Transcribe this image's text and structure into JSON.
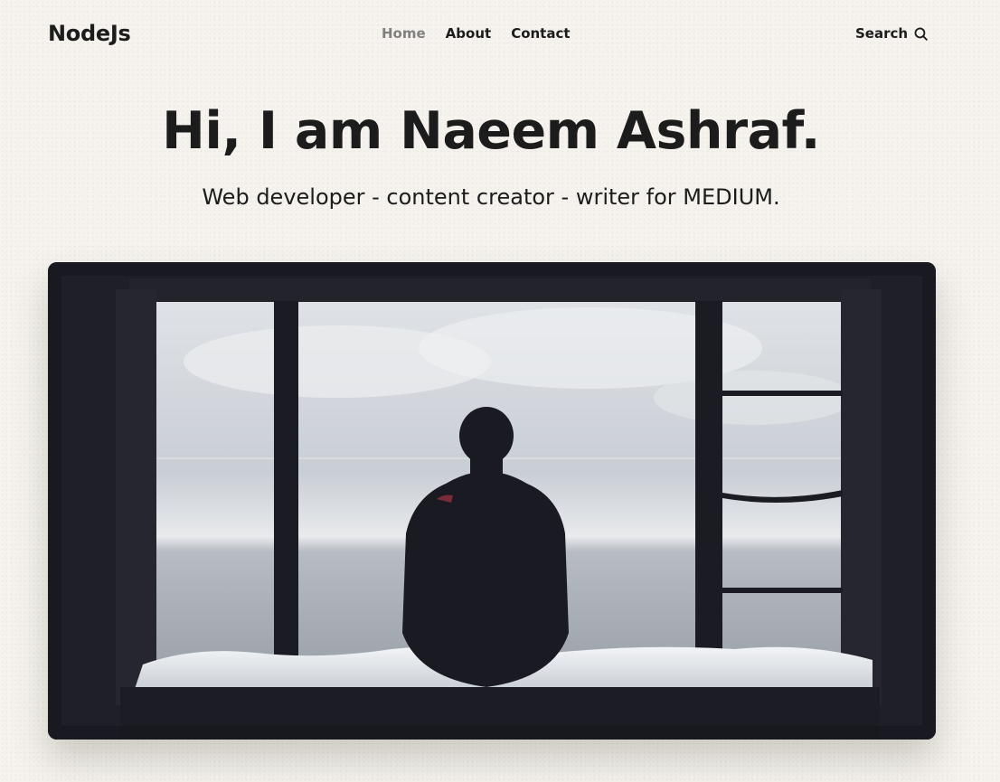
{
  "header": {
    "logo": "NodeJs",
    "nav": [
      {
        "label": "Home",
        "active": true
      },
      {
        "label": "About",
        "active": false
      },
      {
        "label": "Contact",
        "active": false
      }
    ],
    "search_label": "Search",
    "search_icon": "search-icon"
  },
  "hero": {
    "title": "Hi, I am Naeem Ashraf.",
    "subtitle": "Web developer - content creator - writer for MEDIUM."
  },
  "colors": {
    "background": "#f6f3ee",
    "text": "#1c1c1c",
    "nav_active": "#808080",
    "image_frame": "#1f1f28"
  }
}
